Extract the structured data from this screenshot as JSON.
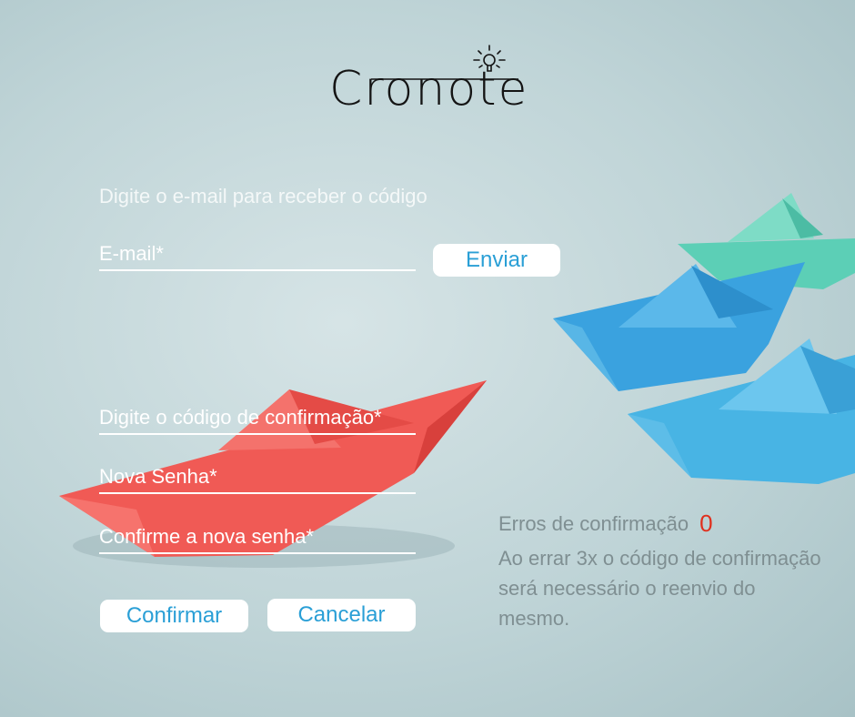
{
  "brand": {
    "name": "Cronote",
    "icon": "lightbulb-icon"
  },
  "email_section": {
    "prompt": "Digite o e-mail para receber o código",
    "email_placeholder": "E-mail*",
    "send_label": "Enviar"
  },
  "reset_section": {
    "code_placeholder": "Digite o código de confirmação*",
    "new_password_placeholder": "Nova Senha*",
    "confirm_password_placeholder": "Confirme a nova senha*",
    "confirm_label": "Confirmar",
    "cancel_label": "Cancelar"
  },
  "info": {
    "errors_label": "Erros de confirmação",
    "errors_count": "0",
    "note": "Ao errar 3x o código de confirmação será necessário o reenvio do mesmo."
  },
  "colors": {
    "accent": "#2a9fd6",
    "error": "#e0301e",
    "boat_red": "#f05a55",
    "boat_blue": "#3eaee0",
    "boat_teal": "#5ccfb6"
  }
}
